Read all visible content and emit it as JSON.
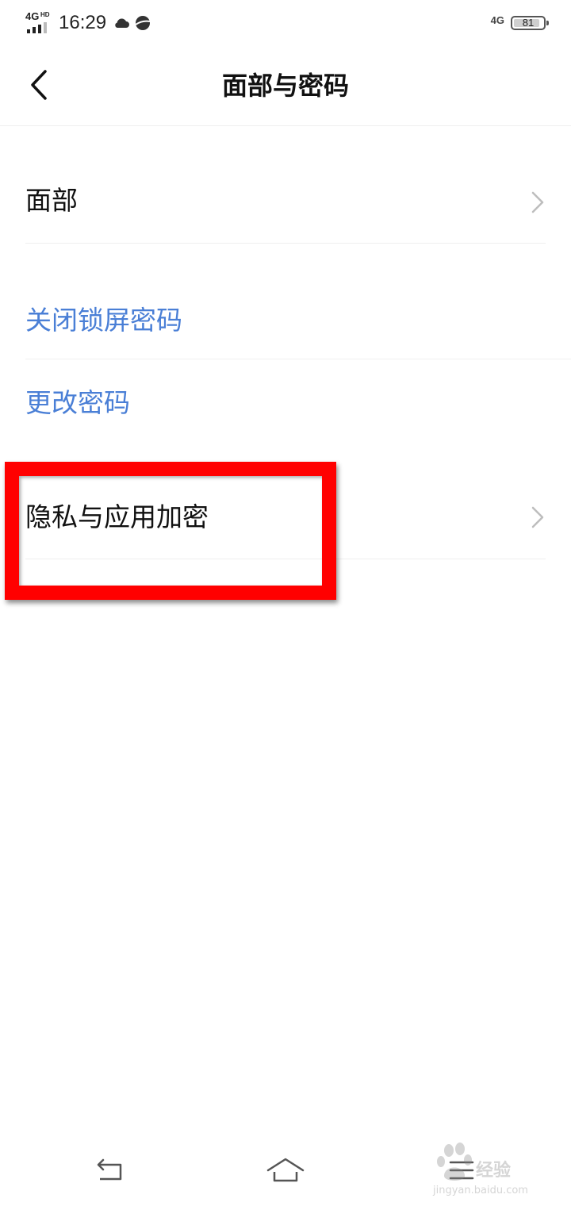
{
  "status_bar": {
    "network_left": "4G",
    "network_left_badge": "HD",
    "time": "16:29",
    "weather_icon": "cloud-icon",
    "browser_icon": "planet-icon",
    "network_right": "4G",
    "battery_level": "81"
  },
  "header": {
    "title": "面部与密码",
    "back_icon": "chevron-left-icon"
  },
  "items": [
    {
      "label": "面部",
      "style": "normal",
      "has_arrow": true
    },
    {
      "label": "关闭锁屏密码",
      "style": "link",
      "has_arrow": false
    },
    {
      "label": "更改密码",
      "style": "link",
      "has_arrow": false
    },
    {
      "label": "隐私与应用加密",
      "style": "normal",
      "has_arrow": true
    }
  ],
  "annotation": {
    "highlight_color": "#ff0000",
    "target": "隐私与应用加密"
  },
  "nav_bar": {
    "back_icon": "return-arrow-icon",
    "home_icon": "home-icon",
    "menu_icon": "menu-icon"
  },
  "watermark": {
    "text": "经验",
    "subtext": "jingyan.baidu.com"
  },
  "colors": {
    "link": "#4a7fd6",
    "text": "#111111",
    "divider": "#efefef"
  }
}
